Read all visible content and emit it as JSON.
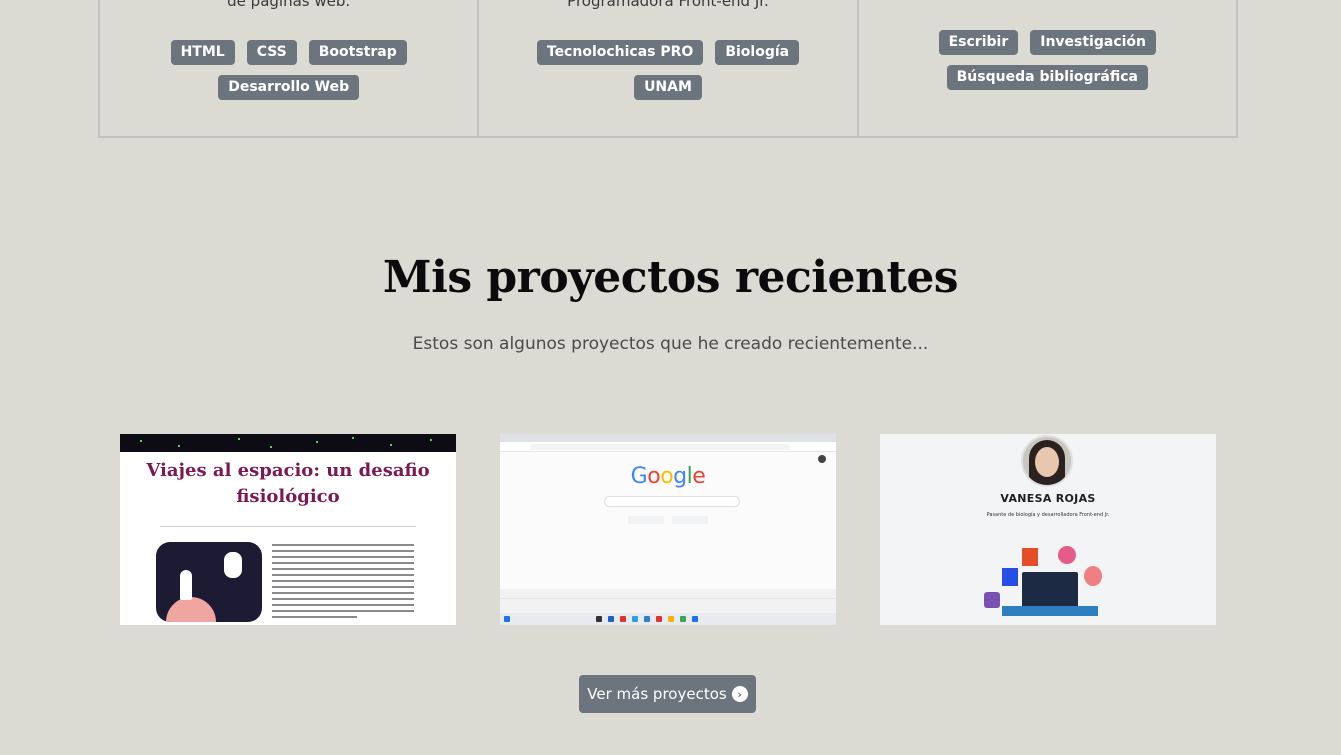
{
  "cards": [
    {
      "cut_text": "de páginas web.",
      "tags": [
        "HTML",
        "CSS",
        "Bootstrap",
        "Desarrollo Web"
      ]
    },
    {
      "cut_text": "Programadora Front-end Jr.",
      "tags": [
        "Tecnolochicas PRO",
        "Biología",
        "UNAM"
      ]
    },
    {
      "cut_text": "",
      "tags": [
        "Escribir",
        "Investigación",
        "Búsqueda bibliográfica"
      ]
    }
  ],
  "projects_section": {
    "title": "Mis proyectos recientes",
    "subtitle": "Estos son algunos proyectos que he creado recientemente..."
  },
  "projects": [
    {
      "thumbnail": "space-travel-page",
      "title": "Viajes al espacio: un desafio fisiológico"
    },
    {
      "thumbnail": "google-clone-page",
      "logo_text": "Google"
    },
    {
      "thumbnail": "portfolio-page",
      "name": "VANESA ROJAS",
      "role": "Pasante de biología y desarrolladora Front-end Jr."
    }
  ],
  "more_button": {
    "label": "Ver más proyectos",
    "icon": "arrow-right-circle-icon"
  }
}
